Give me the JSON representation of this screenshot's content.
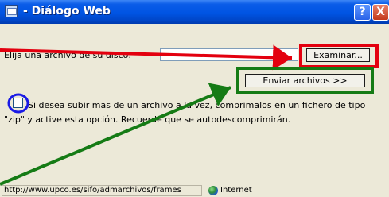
{
  "window": {
    "title": " - Diálogo Web",
    "help_label": "?",
    "close_label": "X"
  },
  "form": {
    "prompt": "Elija una archivo de su disco:",
    "file_value": "",
    "examinar_label": "Examinar...",
    "enviar_label": "Enviar archivos >>",
    "checkbox_checked": false,
    "note": "Si desea subir mas de un archivo a la vez, comprimalos en un fichero de tipo \"zip\" y active esta opción. Recuerde que se autodescomprimirán."
  },
  "statusbar": {
    "url": "http://www.upco.es/sifo/admarchivos/frames",
    "zone": "Internet"
  },
  "colors": {
    "annotation_red": "#e3000f",
    "annotation_green": "#157b15",
    "annotation_blue": "#1a1ae6",
    "titlebar": "#0054e3"
  }
}
